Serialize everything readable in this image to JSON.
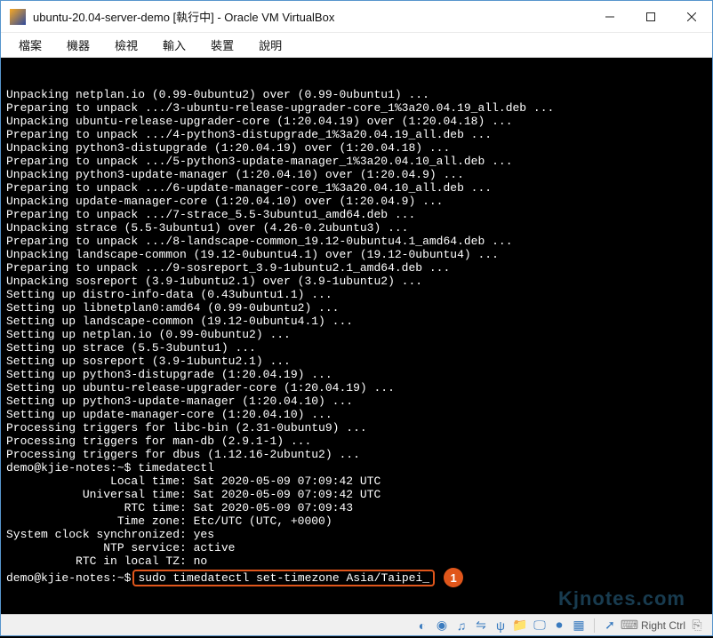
{
  "window": {
    "title": "ubuntu-20.04-server-demo [執行中] - Oracle VM VirtualBox"
  },
  "menu": {
    "file": "檔案",
    "machine": "機器",
    "view": "檢視",
    "input": "輸入",
    "devices": "裝置",
    "help": "說明"
  },
  "terminal_lines": [
    "Unpacking netplan.io (0.99-0ubuntu2) over (0.99-0ubuntu1) ...",
    "Preparing to unpack .../3-ubuntu-release-upgrader-core_1%3a20.04.19_all.deb ...",
    "Unpacking ubuntu-release-upgrader-core (1:20.04.19) over (1:20.04.18) ...",
    "Preparing to unpack .../4-python3-distupgrade_1%3a20.04.19_all.deb ...",
    "Unpacking python3-distupgrade (1:20.04.19) over (1:20.04.18) ...",
    "Preparing to unpack .../5-python3-update-manager_1%3a20.04.10_all.deb ...",
    "Unpacking python3-update-manager (1:20.04.10) over (1:20.04.9) ...",
    "Preparing to unpack .../6-update-manager-core_1%3a20.04.10_all.deb ...",
    "Unpacking update-manager-core (1:20.04.10) over (1:20.04.9) ...",
    "Preparing to unpack .../7-strace_5.5-3ubuntu1_amd64.deb ...",
    "Unpacking strace (5.5-3ubuntu1) over (4.26-0.2ubuntu3) ...",
    "Preparing to unpack .../8-landscape-common_19.12-0ubuntu4.1_amd64.deb ...",
    "Unpacking landscape-common (19.12-0ubuntu4.1) over (19.12-0ubuntu4) ...",
    "Preparing to unpack .../9-sosreport_3.9-1ubuntu2.1_amd64.deb ...",
    "Unpacking sosreport (3.9-1ubuntu2.1) over (3.9-1ubuntu2) ...",
    "Setting up distro-info-data (0.43ubuntu1.1) ...",
    "Setting up libnetplan0:amd64 (0.99-0ubuntu2) ...",
    "Setting up landscape-common (19.12-0ubuntu4.1) ...",
    "Setting up netplan.io (0.99-0ubuntu2) ...",
    "Setting up strace (5.5-3ubuntu1) ...",
    "Setting up sosreport (3.9-1ubuntu2.1) ...",
    "Setting up python3-distupgrade (1:20.04.19) ...",
    "Setting up ubuntu-release-upgrader-core (1:20.04.19) ...",
    "Setting up python3-update-manager (1:20.04.10) ...",
    "Setting up update-manager-core (1:20.04.10) ...",
    "Processing triggers for libc-bin (2.31-0ubuntu9) ...",
    "Processing triggers for man-db (2.9.1-1) ...",
    "Processing triggers for dbus (1.12.16-2ubuntu2) ...",
    "demo@kjie-notes:~$ timedatectl",
    "               Local time: Sat 2020-05-09 07:09:42 UTC",
    "           Universal time: Sat 2020-05-09 07:09:42 UTC",
    "                 RTC time: Sat 2020-05-09 07:09:43",
    "                Time zone: Etc/UTC (UTC, +0000)",
    "System clock synchronized: yes",
    "              NTP service: active",
    "          RTC in local TZ: no"
  ],
  "prompt": {
    "text": "demo@kjie-notes:~$",
    "command": "sudo timedatectl set-timezone Asia/Taipei_",
    "badge": "1"
  },
  "statusbar": {
    "host_key": "Right Ctrl"
  },
  "watermark": "Kjnotes.com"
}
